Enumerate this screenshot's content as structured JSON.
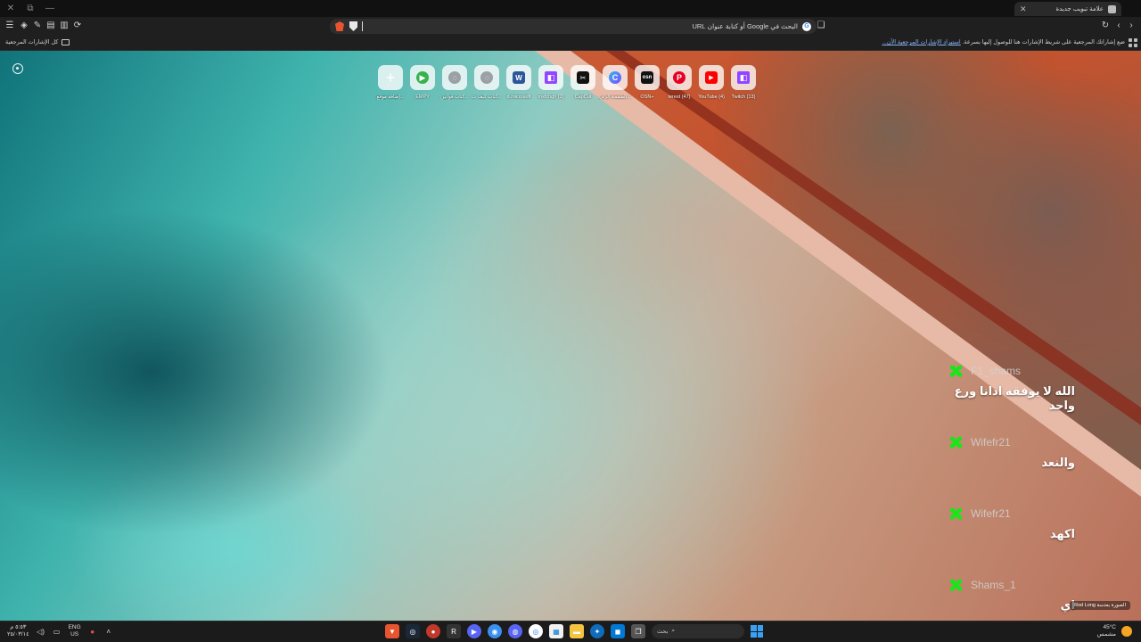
{
  "window": {
    "tab_title": "علامة تبويب جديدة",
    "tab_close": "✕",
    "new_tab": "+"
  },
  "toolbar": {
    "omnibox_placeholder": "البحث في Google أو كتابة عنوان URL"
  },
  "bookmarks": {
    "hint_text": "ضع إشاراتك المرجعية على شريط الإشارات هنا للوصول إليها بسرعة.",
    "import_link": "استيراد الإشارات المرجعية الآن...",
    "all_bookmarks": "كل الإشارات المرجعية"
  },
  "top_sites": [
    {
      "label": "إضافة موقع...",
      "icon": "plus-icon",
      "glyph": "+"
    },
    {
      "label": "EMPY",
      "icon": "play-icon",
      "glyph": "▶"
    },
    {
      "label": "كتاب قوانين...",
      "icon": "globe-icon",
      "glyph": "◌"
    },
    {
      "label": "كتاب كيف ت...",
      "icon": "globe-icon",
      "glyph": "◌"
    },
    {
      "label": "d.microsoft",
      "icon": "word-icon",
      "glyph": "W"
    },
    {
      "label": "mxfchgh (2)",
      "icon": "twitch-icon",
      "glyph": "◧"
    },
    {
      "label": "CapCut",
      "icon": "capcut-icon",
      "glyph": "✂"
    },
    {
      "label": "الصفحة الرئي...",
      "icon": "copilot-icon",
      "glyph": "C"
    },
    {
      "label": "OSN+",
      "icon": "osn-icon",
      "glyph": "osn"
    },
    {
      "label": "terest (47)",
      "icon": "pinterest-icon",
      "glyph": "P"
    },
    {
      "label": "YouTube (4)",
      "icon": "youtube-icon",
      "glyph": "▶"
    },
    {
      "label": "Twitch (13)",
      "icon": "twitch-icon",
      "glyph": "◧"
    }
  ],
  "chat": [
    {
      "user": "F1_shams",
      "text": "الله لا يوفقه ادانا ورع واحد"
    },
    {
      "user": "Wifefr21",
      "text": "والنعد"
    },
    {
      "user": "Wifefr21",
      "text": "اكهد"
    },
    {
      "user": "Shams_1",
      "text": "اي"
    }
  ],
  "credit": "الصورة بعدسة Rod Long",
  "taskbar": {
    "time": "٥:٥٣ م",
    "date": "٢٥/٠٣/١٤",
    "lang_line1": "ENG",
    "lang_line2": "US",
    "search_placeholder": "بحث",
    "temperature": "45°C",
    "weather_desc": "مشمس"
  },
  "colors": {
    "accent_link": "#8ab4f8",
    "chat_platform": "#19e619",
    "windows_blue": "#3aa0f3"
  }
}
